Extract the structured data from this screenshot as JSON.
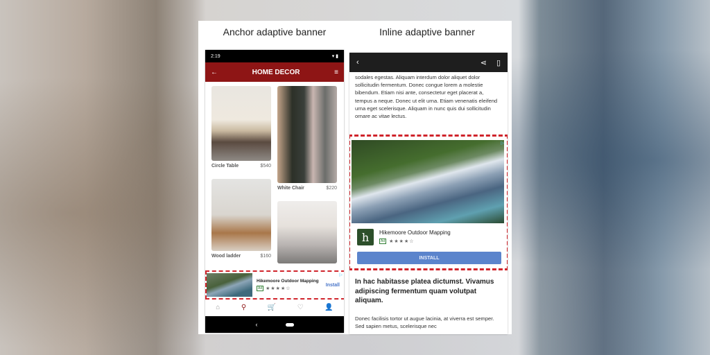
{
  "captions": {
    "left": "Anchor adaptive banner",
    "right": "Inline adaptive banner"
  },
  "anchor_phone": {
    "status_time": "2:19",
    "status_icons": "▾ ▮",
    "appbar": {
      "back_icon": "←",
      "title": "HOME DECOR",
      "filter_icon": "≡"
    },
    "products": [
      {
        "name": "Circle Table",
        "price": "$540"
      },
      {
        "name": "White Chair",
        "price": "$220"
      },
      {
        "name": "Wood ladder",
        "price": "$160"
      },
      {
        "name": "",
        "price": ""
      }
    ],
    "ad": {
      "title": "Hikemoore Outdoor Mapping",
      "badge": "Ad",
      "stars": "★★★★☆",
      "rating": 4,
      "install": "Install",
      "adchoices_icon": "▷"
    },
    "bottom_nav": [
      "home-icon",
      "search-icon",
      "cart-icon",
      "heart-icon",
      "person-icon"
    ],
    "bottom_nav_glyphs": [
      "⌂",
      "⚲",
      "🛒",
      "♡",
      "👤"
    ],
    "system_nav": {
      "back": "‹"
    }
  },
  "inline_phone": {
    "topbar": {
      "back_icon": "‹",
      "share_icon": "⋖",
      "bookmark_icon": "▯"
    },
    "paragraph1": "sodales egestas. Aliquam interdum dolor aliquet dolor sollicitudin fermentum. Donec congue lorem a molestie bibendum. Etiam nisi ante, consectetur eget placerat a, tempus a neque. Donec ut elit urna. Etiam venenatis eleifend urna eget scelerisque. Aliquam in nunc quis dui sollicitudin ornare ac vitae lectus.",
    "ad": {
      "app_logo_letter": "h",
      "title": "Hikemoore Outdoor Mapping",
      "badge": "Ad",
      "stars": "★★★★☆",
      "rating": 4,
      "install": "INSTALL",
      "adchoices_icon": "▷"
    },
    "heading": "In hac habitasse platea dictumst. Vivamus adipiscing fermentum quam volutpat aliquam.",
    "paragraph2": "Donec facilisis tortor ut augue lacinia, at viverra est semper. Sed sapien metus, scelerisque nec"
  },
  "colors": {
    "brand_red": "#8e1515",
    "ad_border": "#d0242b",
    "install_blue": "#5b84cc"
  }
}
